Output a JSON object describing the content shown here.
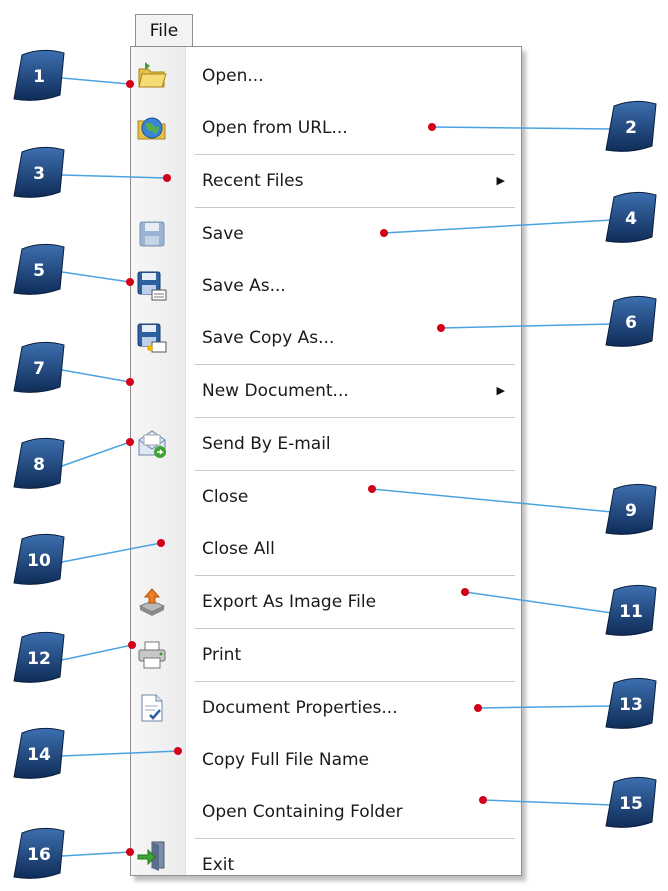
{
  "menu": {
    "title": "File",
    "items": [
      {
        "label": "Open...",
        "icon": "open-folder-icon",
        "submenu": false
      },
      {
        "label": "Open from URL...",
        "icon": "globe-icon",
        "submenu": false
      },
      {
        "label": "Recent Files",
        "icon": "",
        "submenu": true
      },
      {
        "label": "Save",
        "icon": "save-disk-icon",
        "submenu": false
      },
      {
        "label": "Save As...",
        "icon": "save-as-icon",
        "submenu": false
      },
      {
        "label": "Save Copy As...",
        "icon": "save-copy-icon",
        "submenu": false
      },
      {
        "label": "New Document...",
        "icon": "",
        "submenu": true
      },
      {
        "label": "Send By E-mail",
        "icon": "email-icon",
        "submenu": false
      },
      {
        "label": "Close",
        "icon": "",
        "submenu": false
      },
      {
        "label": "Close All",
        "icon": "",
        "submenu": false
      },
      {
        "label": "Export As Image File",
        "icon": "export-image-icon",
        "submenu": false
      },
      {
        "label": "Print",
        "icon": "printer-icon",
        "submenu": false
      },
      {
        "label": "Document Properties...",
        "icon": "document-properties-icon",
        "submenu": false
      },
      {
        "label": "Copy Full File Name",
        "icon": "",
        "submenu": false
      },
      {
        "label": "Open Containing Folder",
        "icon": "",
        "submenu": false
      },
      {
        "label": "Exit",
        "icon": "exit-door-icon",
        "submenu": false
      }
    ],
    "submenu_arrow": "▶"
  },
  "callouts": [
    "1",
    "2",
    "3",
    "4",
    "5",
    "6",
    "7",
    "8",
    "9",
    "10",
    "11",
    "12",
    "13",
    "14",
    "15",
    "16"
  ],
  "colors": {
    "badge_top": "#3d6fb0",
    "badge_bottom": "#0f2c57",
    "leader_line": "#4aa3e0",
    "dot": "#d4001a"
  }
}
